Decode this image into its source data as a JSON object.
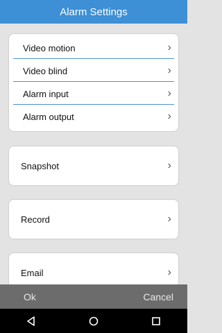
{
  "header": {
    "title": "Alarm Settings"
  },
  "group_items": [
    {
      "label": "Video motion",
      "icon": "chevron-right-icon"
    },
    {
      "label": "Video blind",
      "icon": "chevron-right-icon"
    },
    {
      "label": "Alarm input",
      "icon": "chevron-right-icon"
    },
    {
      "label": "Alarm output",
      "icon": "chevron-right-icon"
    }
  ],
  "snapshot": {
    "label": "Snapshot"
  },
  "record": {
    "label": "Record"
  },
  "email": {
    "label": "Email"
  },
  "footer": {
    "ok_label": "Ok",
    "cancel_label": "Cancel"
  },
  "colors": {
    "header_bg": "#3d8fd6",
    "separator": "#4d8fd0",
    "footer_bg": "#6c6c6c"
  },
  "nav_icons": [
    "back-icon",
    "home-icon",
    "recents-icon"
  ]
}
